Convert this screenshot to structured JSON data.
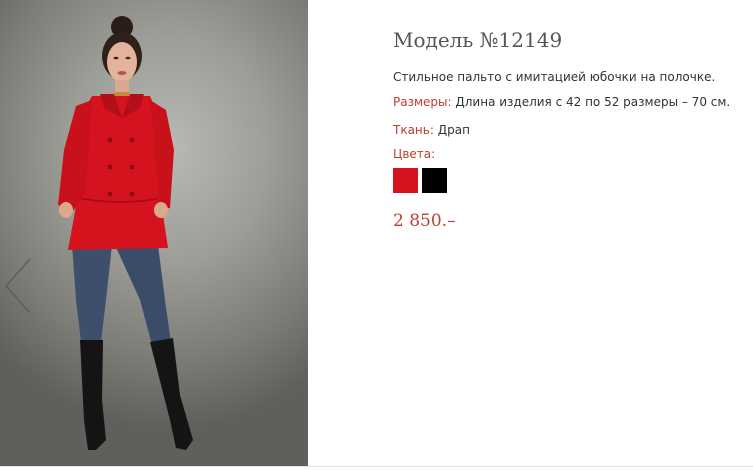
{
  "product": {
    "title": "Модель №12149",
    "description": "Стильное пальто с имитацией юбочки на полочке.",
    "sizes_label": "Размеры:",
    "sizes_value": "Длина изделия с 42 по 52 размеры – 70 см.",
    "fabric_label": "Ткань:",
    "fabric_value": "Драп",
    "colors_label": "Цвета:",
    "colors": [
      "#d4131f",
      "#000000"
    ],
    "price": "2 850.–"
  },
  "gallery": {
    "prev_icon": "chevron-left-icon"
  },
  "theme": {
    "accent": "#b8402f",
    "coat": "#d4131f"
  }
}
